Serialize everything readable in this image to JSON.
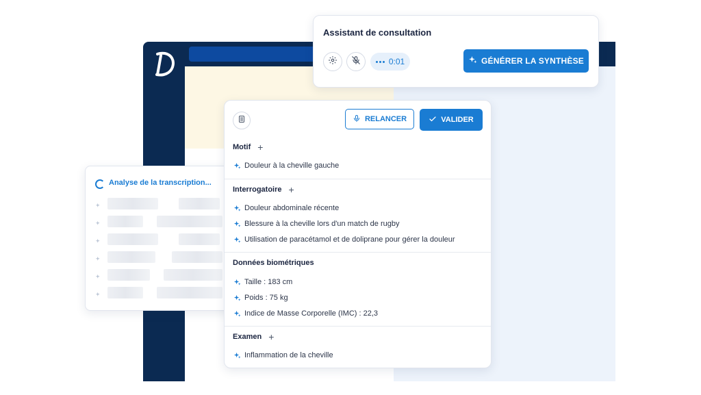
{
  "colors": {
    "accent": "#1a7cd3",
    "navy": "#0b2a52"
  },
  "app": {
    "logo_icon": "d-logo-icon"
  },
  "assistant": {
    "title": "Assistant de consultation",
    "timer": "0:01",
    "generate_label": "GÉNÉRER LA SYNTHÈSE",
    "icons": [
      "gear-icon",
      "microphone-off-icon",
      "sparkle-icon"
    ]
  },
  "transcription": {
    "title": "Analyse de la transcription...",
    "skeleton_rows": 6
  },
  "main": {
    "relancer_label": "RELANCER",
    "valider_label": "VALIDER",
    "sections": [
      {
        "title": "Motif",
        "items": [
          "Douleur à la cheville gauche"
        ]
      },
      {
        "title": "Interrogatoire",
        "items": [
          "Douleur abdominale récente",
          "Blessure à la cheville lors d'un match de rugby",
          "Utilisation de paracétamol et de doliprane pour gérer la douleur"
        ]
      },
      {
        "title": "Données biométriques",
        "items": [
          "Taille : 183 cm",
          "Poids : 75 kg",
          "Indice de Masse Corporelle (IMC) : 22,3"
        ]
      },
      {
        "title": "Examen",
        "items": [
          "Inflammation de la cheville"
        ]
      }
    ]
  }
}
